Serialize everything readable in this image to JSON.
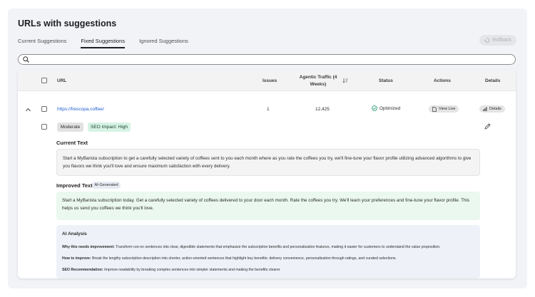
{
  "page": {
    "title": "URLs with suggestions"
  },
  "tabs": [
    {
      "label": "Current Suggestions",
      "active": false
    },
    {
      "label": "Fixed Suggestions",
      "active": true
    },
    {
      "label": "Ignored Suggestions",
      "active": false
    }
  ],
  "rollback": {
    "label": "Rollback",
    "disabled": true
  },
  "search": {
    "value": "",
    "placeholder": ""
  },
  "table": {
    "headers": {
      "url": "URL",
      "issues": "Issues",
      "traffic": "Agentic Traffic (4 Weeks)",
      "status": "Status",
      "actions": "Actions",
      "details": "Details"
    },
    "row": {
      "url": "https://frescopa.coffee/",
      "issues": "1",
      "traffic": "12,425",
      "status": "Optimized",
      "view_live": "View Live",
      "details": "Details"
    }
  },
  "suggestion": {
    "severity": "Moderate",
    "impact": "SEO Impact: High",
    "current_title": "Current Text",
    "current_text": "Start a MyBarista subscription to get a carefully selected variety of coffees sent to you each month where as you rate the coffees you try, we'll fine-tune your flavor profile utilizing advanced algorithms to give you flavors we think you'll love and ensure maximum satisfaction with every delivery.",
    "improved_title": "Improved Text",
    "ai_badge": "AI-Generated",
    "improved_text": "Start a MyBarista subscription today. Get a carefully selected variety of coffees delivered to your door each month. Rate the coffees you try. We'll learn your preferences and fine-tune your flavor profile. This helps us send you coffees we think you'll love.",
    "analysis": {
      "title": "AI Analysis",
      "why_label": "Why this needs improvement:",
      "why_text": "Transform run-on sentences into clear, digestible statements that emphasize the subscription benefits and personalization features, making it easier for customers to understand the value proposition.",
      "how_label": "How to improve:",
      "how_text": "Break the lengthy subscription description into shorter, action-oriented sentences that highlight key benefits: delivery convenience, personalization through ratings, and curated selections.",
      "seo_label": "SEO Recommendation:",
      "seo_text": "Improve readability by breaking complex sentences into simpler statements and making the benefits clearer"
    }
  },
  "colors": {
    "link": "#1d5fd0",
    "optimized": "#2d9d78",
    "impact_bg": "#d6f3e4",
    "improved_bg": "#eaf8ef",
    "analysis_bg": "#eef1f8"
  }
}
